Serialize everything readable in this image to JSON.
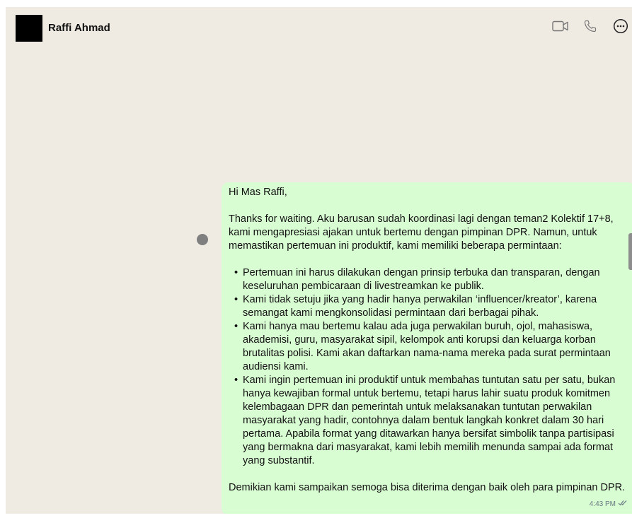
{
  "header": {
    "contact_name": "Raffi Ahmad",
    "icons": [
      "video-call-icon",
      "voice-call-icon",
      "more-options-icon"
    ]
  },
  "message": {
    "greeting": "Hi Mas Raffi,",
    "intro": "Thanks for waiting. Aku barusan sudah koordinasi lagi dengan teman2 Kolektif 17+8, kami mengapresiasi ajakan untuk bertemu dengan pimpinan DPR. Namun, untuk memastikan pertemuan ini produktif, kami memiliki beberapa permintaan:",
    "points": [
      "Pertemuan ini harus dilakukan dengan prinsip terbuka dan transparan, dengan keseluruhan pembicaraan di livestreamkan ke publik.",
      "Kami tidak setuju jika yang hadir hanya perwakilan ‘influencer/kreator’, karena semangat kami mengkonsolidasi permintaan dari berbagai pihak.",
      "Kami hanya mau bertemu kalau ada juga perwakilan buruh, ojol, mahasiswa, akademisi, guru, masyarakat sipil, kelompok anti korupsi dan keluarga korban brutalitas polisi. Kami akan daftarkan nama-nama mereka pada surat permintaan audiensi kami.",
      "Kami ingin pertemuan ini produktif untuk membahas tuntutan satu per satu, bukan hanya kewajiban formal untuk bertemu, tetapi harus lahir suatu produk komitmen kelembagaan DPR dan pemerintah untuk melaksanakan tuntutan perwakilan masyarakat yang hadir, contohnya dalam bentuk langkah konkret dalam 30 hari pertama. Apabila format yang ditawarkan hanya bersifat simbolik tanpa partisipasi yang bermakna dari masyarakat, kami lebih memilih menunda sampai ada format yang substantif."
    ],
    "closing": "Demikian kami sampaikan semoga bisa diterima dengan baik oleh para pimpinan DPR.",
    "time": "4:43 PM",
    "status_icon": "double-check-icon"
  },
  "colors": {
    "chat_background": "#efeae2",
    "outgoing_bubble": "#d9fdd3",
    "presence_dot": "#7f7f7f"
  }
}
